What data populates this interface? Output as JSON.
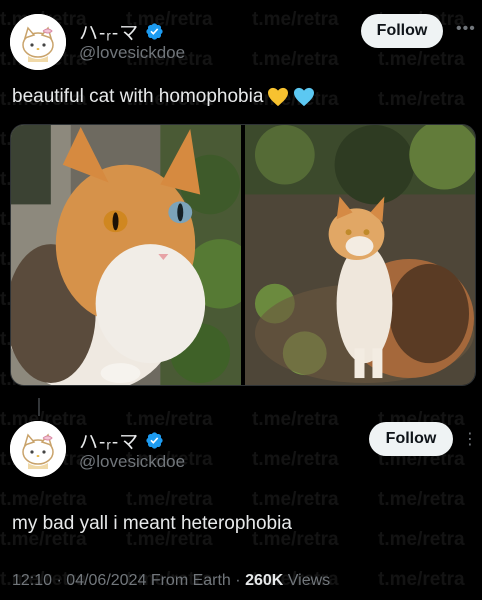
{
  "watermark_text": "t.me/retra",
  "posts": [
    {
      "display_name": "ハ-ᵣ-マ",
      "handle": "@lovesickdoe",
      "follow_label": "Follow",
      "text": "beautiful cat with homophobia",
      "emojis": [
        "yellow-heart-icon",
        "light-blue-heart-icon"
      ]
    },
    {
      "display_name": "ハ-ᵣ-マ",
      "handle": "@lovesickdoe",
      "follow_label": "Follow",
      "text": "my bad yall i meant heterophobia"
    }
  ],
  "meta": {
    "time": "12:10",
    "date": "04/06/2024",
    "location": "From Earth",
    "views_count": "260K",
    "views_label": "Views"
  },
  "colors": {
    "background": "#000000",
    "verified": "#1d9bf0",
    "follow_button_bg": "#eff3f4",
    "muted": "#71767b"
  }
}
